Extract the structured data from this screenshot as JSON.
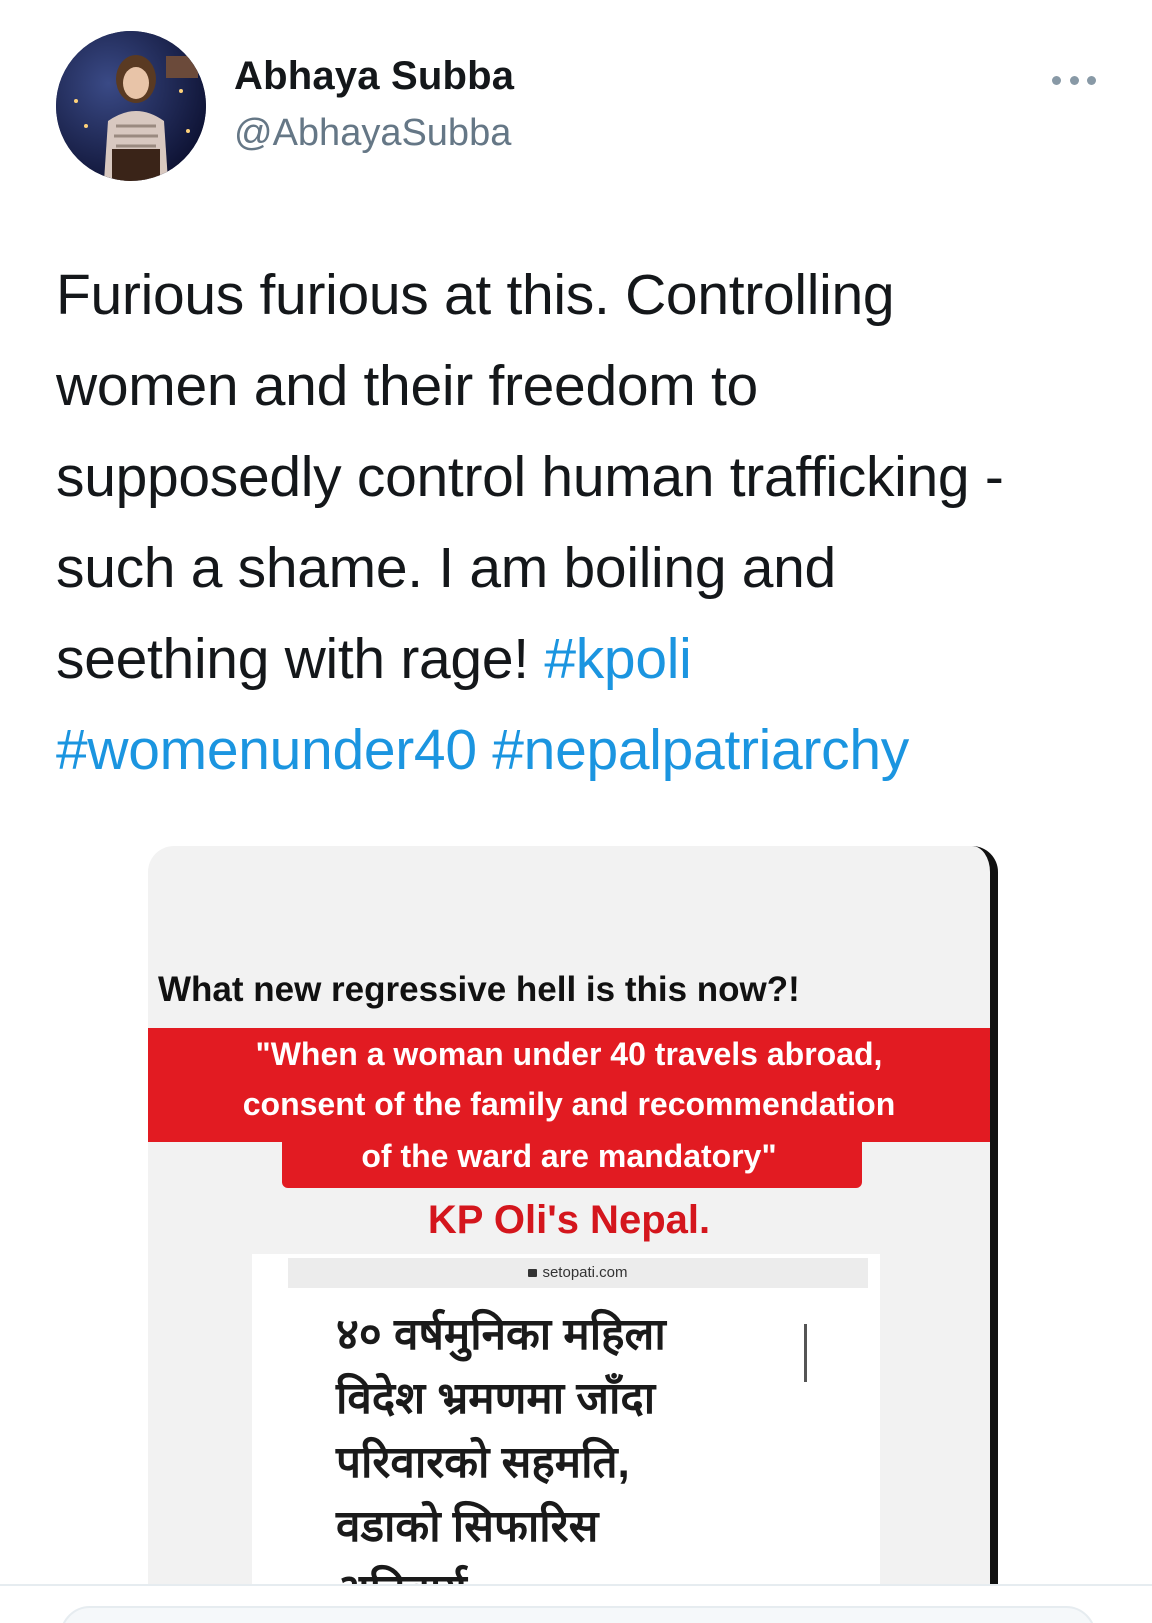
{
  "author": {
    "name": "Abhaya Subba",
    "handle": "@AbhayaSubba"
  },
  "tweet": {
    "line1": "Furious furious at this. Controlling",
    "line2": "women and their freedom to",
    "line3": "supposedly control human trafficking -",
    "line4": "such a shame. I am boiling and",
    "line5_text": "seething with rage! ",
    "hashtags": [
      "#kpoli",
      "#womenunder40",
      "#nepalpatriarchy"
    ],
    "hashtag_color": "#1b95e0"
  },
  "media": {
    "headline": "What new regressive hell is this now?!",
    "quote": [
      "\"When a woman under 40 travels abroad,",
      "consent of the family and recommendation",
      "of the ward are mandatory\""
    ],
    "attribution": "KP Oli's Nepal.",
    "accent_red": "#e21b22",
    "article": {
      "url": "setopati.com",
      "lines": [
        "४० वर्षमुनिका महिला",
        "विदेश भ्रमणमा जाँदा",
        "परिवारको सहमति,",
        "वडाको सिफारिस",
        "अनिवार्य"
      ]
    }
  },
  "icons": {
    "more": "more-options-icon",
    "lock": "lock-icon"
  }
}
